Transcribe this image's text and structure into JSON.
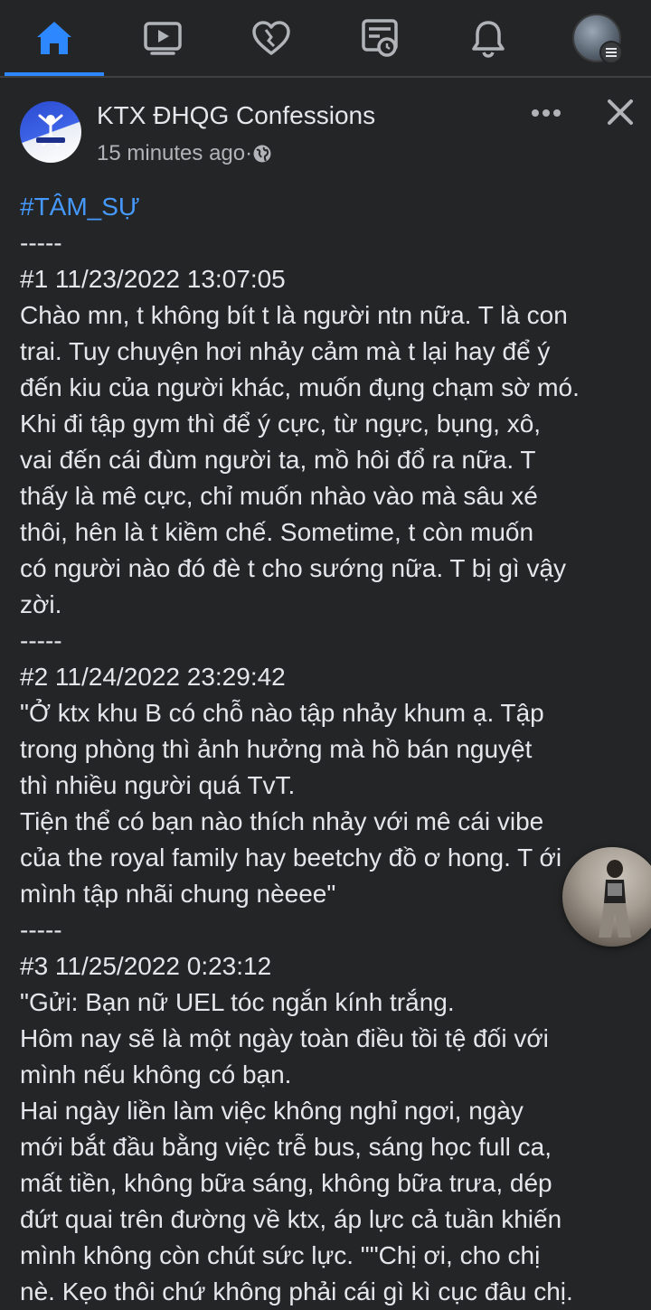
{
  "nav": {
    "tabs": [
      {
        "name": "home",
        "icon": "home-icon",
        "active": true
      },
      {
        "name": "watch",
        "icon": "video-icon",
        "active": false
      },
      {
        "name": "dating",
        "icon": "heart-icon",
        "active": false
      },
      {
        "name": "feeds",
        "icon": "news-feed-icon",
        "active": false
      },
      {
        "name": "notifications",
        "icon": "bell-icon",
        "active": false
      },
      {
        "name": "menu",
        "icon": "profile-avatar",
        "active": false
      }
    ],
    "accent_color": "#2d88ff"
  },
  "post": {
    "page_name": "KTX ĐHQG Confessions",
    "timestamp": "15 minutes ago",
    "separator": " · ",
    "privacy_icon": "globe-icon",
    "lines": [
      "#TÂM_SỰ",
      "-----",
      "#1 11/23/2022 13:07:05",
      "Chào mn, t không bít t là người ntn nữa. T là con",
      "trai. Tuy chuyện hơi nhảy cảm mà t lại hay để ý",
      "đến kiu của người khác, muốn đụng chạm sờ mó.",
      "Khi đi tập gym thì để ý cực, từ ngực, bụng, xô,",
      "vai đến cái đùm người ta, mồ hôi đổ ra nữa. T",
      "thấy là mê cực, chỉ muốn nhào vào mà sâu xé",
      "thôi, hên là t kiềm chế. Sometime, t còn muốn",
      "có người nào đó đè t cho sướng nữa. T bị gì vậy",
      "zời.",
      "-----",
      "#2 11/24/2022 23:29:42",
      "\"Ở ktx khu B có chỗ nào tập nhảy khum ạ. Tập",
      "trong phòng thì ảnh hưởng mà hồ bán nguyệt",
      "thì nhiều người quá TvT.",
      "Tiện thể có bạn nào thích nhảy với mê cái vibe",
      "của the royal family hay beetchy đồ ơ hong. T ới",
      "mình tập nhãi chung nèeee\"",
      "-----",
      "#3 11/25/2022 0:23:12",
      "\"Gửi: Bạn nữ UEL tóc ngắn kính trắng.",
      "Hôm nay sẽ là một ngày toàn điều tồi tệ đối với",
      "mình nếu không có bạn.",
      "Hai ngày liền làm việc không nghỉ ngơi, ngày",
      "mới bắt đầu bằng việc trễ bus, sáng học full ca,",
      "mất tiền, không bữa sáng, không bữa trưa, dép",
      "đứt quai trên đường về ktx, áp lực cả tuần khiến",
      "mình không còn chút sức lực. \"\"Chị ơi, cho chị",
      "nè. Kẹo thôi chứ không phải cái gì kì cục đâu chị."
    ],
    "hashtag_color": "#4599ff"
  },
  "chat_head": {
    "icon": "chat-head-avatar"
  }
}
